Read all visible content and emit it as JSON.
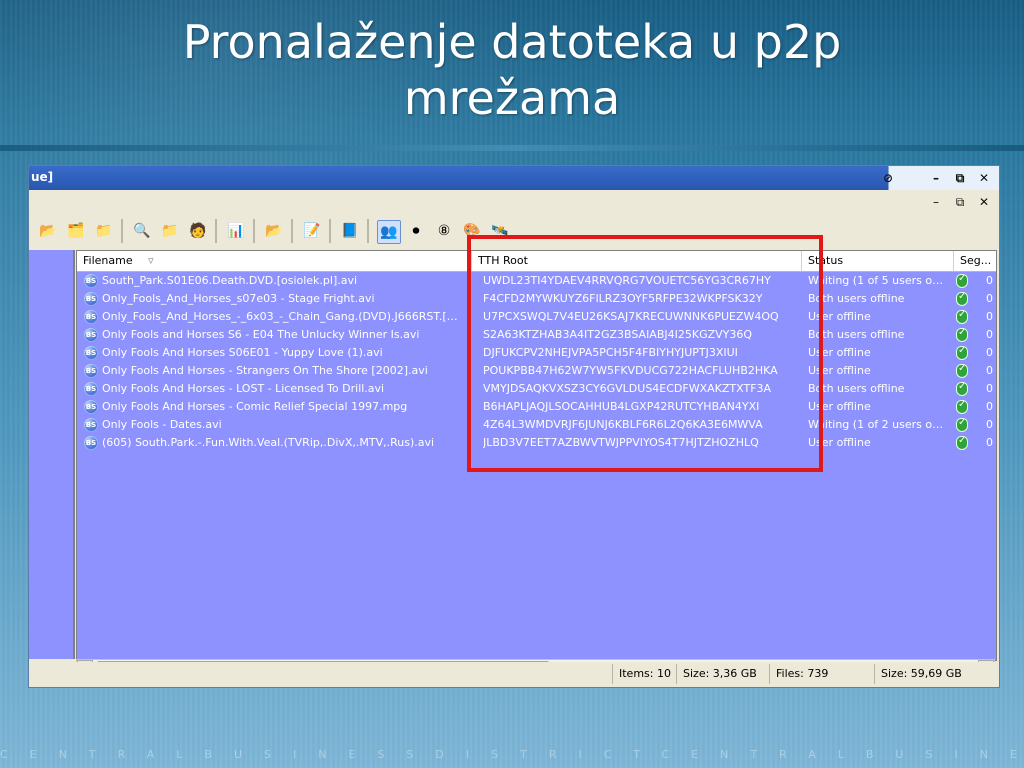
{
  "slide": {
    "title_line1": "Pronalaženje datoteka u p2p",
    "title_line2": "mrežama",
    "footer_text": "CENTRALBUSINESSDISTRICTCENTRALBUSINESSDISTRICTCENTRAL"
  },
  "window": {
    "title_partial": "ue]"
  },
  "toolbar": {
    "icons": [
      "folder-icon",
      "folder-refresh-icon",
      "folder-star-icon",
      "search-icon",
      "folder-search-icon",
      "avatar-icon",
      "chart-icon",
      "folder-open-icon",
      "edit-icon",
      "book-icon",
      "users-icon",
      "stop-icon",
      "speed-icon",
      "colorful-icon",
      "network-icon"
    ]
  },
  "grid": {
    "headers": {
      "filename": "Filename",
      "tth": "TTH Root",
      "status": "Status",
      "seg": "Seg..."
    },
    "rows": [
      {
        "filename": "South_Park.S01E06.Death.DVD.[osiolek.pl].avi",
        "tth": "UWDL23TI4YDAEV4RRVQRG7VOUETC56YG3CR67HY",
        "status": "Waiting (1 of 5 users onl...",
        "seg": "0"
      },
      {
        "filename": "Only_Fools_And_Horses_s07e03 - Stage Fright.avi",
        "tth": "F4CFD2MYWKUYZ6FILRZ3OYF5RFPE32WKPFSK32Y",
        "status": "Both users offline",
        "seg": "0"
      },
      {
        "filename": "Only_Fools_And_Horses_-_6x03_-_Chain_Gang.(DVD).J666RST.[ww...",
        "tth": "U7PCXSWQL7V4EU26KSAJ7KRECUWNNK6PUEZW4OQ",
        "status": "User offline",
        "seg": "0"
      },
      {
        "filename": "Only Fools and Horses S6 - E04 The Unlucky Winner Is.avi",
        "tth": "S2A63KTZHAB3A4IT2GZ3BSAIABJ4I25KGZVY36Q",
        "status": "Both users offline",
        "seg": "0"
      },
      {
        "filename": "Only Fools And Horses S06E01 - Yuppy Love (1).avi",
        "tth": "DJFUKCPV2NHEJVPA5PCH5F4FBIYHYJUPTJ3XIUI",
        "status": "User offline",
        "seg": "0"
      },
      {
        "filename": "Only Fools And Horses - Strangers On The Shore [2002].avi",
        "tth": "POUKPBB47H62W7YW5FKVDUCG722HACFLUHB2HKA",
        "status": "User offline",
        "seg": "0"
      },
      {
        "filename": "Only Fools And Horses - LOST - Licensed To Drill.avi",
        "tth": "VMYJDSAQKVXSZ3CY6GVLDUS4ECDFWXAKZTXTF3A",
        "status": "Both users offline",
        "seg": "0"
      },
      {
        "filename": "Only Fools And Horses - Comic Relief Special 1997.mpg",
        "tth": "B6HAPLJAQJLSOCAHHUB4LGXP42RUTCYHBAN4YXI",
        "status": "User offline",
        "seg": "0"
      },
      {
        "filename": "Only Fools - Dates.avi",
        "tth": "4Z64L3WMDVRJF6JUNJ6KBLF6R6L2Q6KA3E6MWVA",
        "status": "Waiting (1 of 2 users onl...",
        "seg": "0"
      },
      {
        "filename": "(605) South.Park.-.Fun.With.Veal.(TVRip,.DivX,.MTV,.Rus).avi",
        "tth": "JLBD3V7EET7AZBWVTWJPPVIYOS4T7HJTZHOZHLQ",
        "status": "User offline",
        "seg": "0"
      }
    ]
  },
  "statusbar": {
    "items": "Items: 10",
    "size": "Size: 3,36 GB",
    "files": "Files: 739",
    "total_size": "Size: 59,69 GB"
  },
  "colors": {
    "grid_bg": "#8e92ff",
    "highlight_red": "#e01818"
  }
}
